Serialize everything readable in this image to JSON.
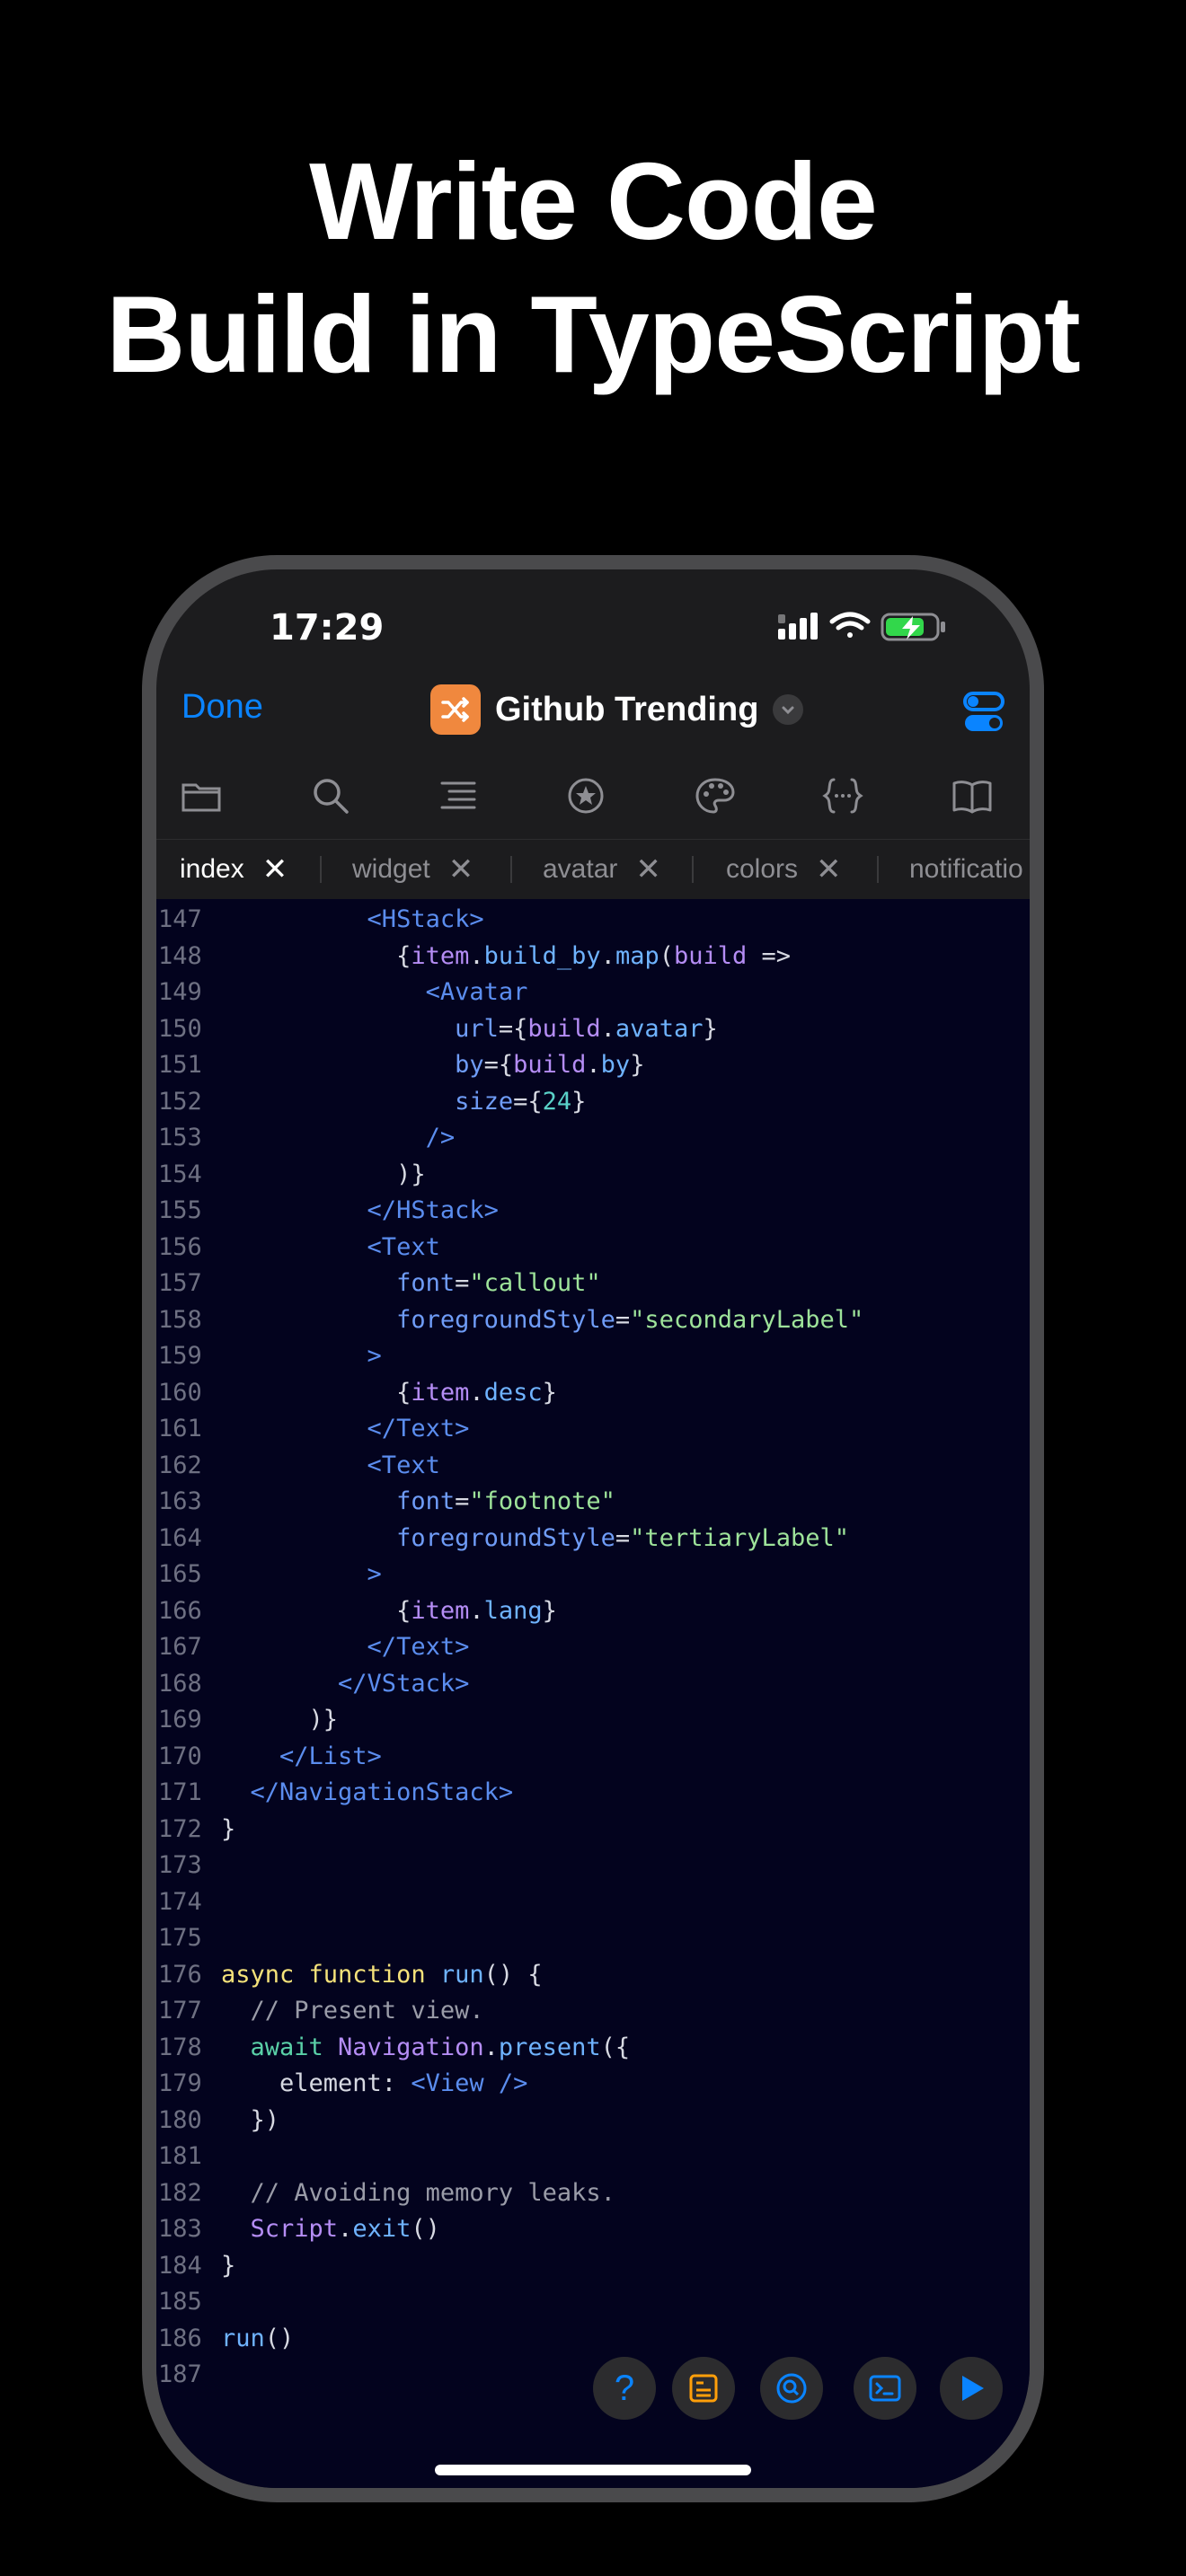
{
  "headline": {
    "line1": "Write Code",
    "line2": "Build in TypeScript"
  },
  "status_bar": {
    "time": "17:29"
  },
  "nav": {
    "done_label": "Done",
    "title": "Github Trending"
  },
  "toolbar_icons": [
    "folder-icon",
    "search-icon",
    "outline-icon",
    "star-icon",
    "palette-icon",
    "braces-icon",
    "book-icon"
  ],
  "tabs": [
    {
      "label": "index",
      "active": true
    },
    {
      "label": "widget"
    },
    {
      "label": "avatar"
    },
    {
      "label": "colors"
    },
    {
      "label": "notificatio"
    }
  ],
  "code": {
    "lines": [
      {
        "n": "147",
        "tokens": [
          [
            "tag",
            "          <HStack>"
          ]
        ]
      },
      {
        "n": "148",
        "tokens": [
          [
            "pl",
            "            {"
          ],
          [
            "prop",
            "item"
          ],
          [
            "pl",
            "."
          ],
          [
            "fn",
            "build_by"
          ],
          [
            "pl",
            "."
          ],
          [
            "fn",
            "map"
          ],
          [
            "pl",
            "("
          ],
          [
            "prop",
            "build"
          ],
          [
            "pl",
            " =>"
          ]
        ]
      },
      {
        "n": "149",
        "tokens": [
          [
            "tag",
            "              <Avatar"
          ]
        ]
      },
      {
        "n": "150",
        "tokens": [
          [
            "attr",
            "                url"
          ],
          [
            "pl",
            "={"
          ],
          [
            "prop",
            "build"
          ],
          [
            "pl",
            "."
          ],
          [
            "fn",
            "avatar"
          ],
          [
            "pl",
            "}"
          ]
        ]
      },
      {
        "n": "151",
        "tokens": [
          [
            "attr",
            "                by"
          ],
          [
            "pl",
            "={"
          ],
          [
            "prop",
            "build"
          ],
          [
            "pl",
            "."
          ],
          [
            "fn",
            "by"
          ],
          [
            "pl",
            "}"
          ]
        ]
      },
      {
        "n": "152",
        "tokens": [
          [
            "attr",
            "                size"
          ],
          [
            "pl",
            "={"
          ],
          [
            "num",
            "24"
          ],
          [
            "pl",
            "}"
          ]
        ]
      },
      {
        "n": "153",
        "tokens": [
          [
            "tag",
            "              />"
          ]
        ]
      },
      {
        "n": "154",
        "tokens": [
          [
            "pl",
            "            )}"
          ]
        ]
      },
      {
        "n": "155",
        "tokens": [
          [
            "tag",
            "          </HStack>"
          ]
        ]
      },
      {
        "n": "156",
        "tokens": [
          [
            "tag",
            "          <Text"
          ]
        ]
      },
      {
        "n": "157",
        "tokens": [
          [
            "attr",
            "            font"
          ],
          [
            "pl",
            "="
          ],
          [
            "str",
            "\"callout\""
          ]
        ]
      },
      {
        "n": "158",
        "tokens": [
          [
            "attr",
            "            foregroundStyle"
          ],
          [
            "pl",
            "="
          ],
          [
            "str",
            "\"secondaryLabel\""
          ]
        ]
      },
      {
        "n": "159",
        "tokens": [
          [
            "tag",
            "          >"
          ]
        ]
      },
      {
        "n": "160",
        "tokens": [
          [
            "pl",
            "            {"
          ],
          [
            "prop",
            "item"
          ],
          [
            "pl",
            "."
          ],
          [
            "fn",
            "desc"
          ],
          [
            "pl",
            "}"
          ]
        ]
      },
      {
        "n": "161",
        "tokens": [
          [
            "tag",
            "          </Text>"
          ]
        ]
      },
      {
        "n": "162",
        "tokens": [
          [
            "tag",
            "          <Text"
          ]
        ]
      },
      {
        "n": "163",
        "tokens": [
          [
            "attr",
            "            font"
          ],
          [
            "pl",
            "="
          ],
          [
            "str",
            "\"footnote\""
          ]
        ]
      },
      {
        "n": "164",
        "tokens": [
          [
            "attr",
            "            foregroundStyle"
          ],
          [
            "pl",
            "="
          ],
          [
            "str",
            "\"tertiaryLabel\""
          ]
        ]
      },
      {
        "n": "165",
        "tokens": [
          [
            "tag",
            "          >"
          ]
        ]
      },
      {
        "n": "166",
        "tokens": [
          [
            "pl",
            "            {"
          ],
          [
            "prop",
            "item"
          ],
          [
            "pl",
            "."
          ],
          [
            "fn",
            "lang"
          ],
          [
            "pl",
            "}"
          ]
        ]
      },
      {
        "n": "167",
        "tokens": [
          [
            "tag",
            "          </Text>"
          ]
        ]
      },
      {
        "n": "168",
        "tokens": [
          [
            "tag",
            "        </VStack>"
          ]
        ]
      },
      {
        "n": "169",
        "tokens": [
          [
            "pl",
            "      )}"
          ]
        ]
      },
      {
        "n": "170",
        "tokens": [
          [
            "tag",
            "    </List>"
          ]
        ]
      },
      {
        "n": "171",
        "tokens": [
          [
            "tag",
            "  </NavigationStack>"
          ]
        ]
      },
      {
        "n": "172",
        "tokens": [
          [
            "pl",
            "}"
          ]
        ]
      },
      {
        "n": "173",
        "tokens": []
      },
      {
        "n": "174",
        "tokens": []
      },
      {
        "n": "175",
        "tokens": []
      },
      {
        "n": "176",
        "tokens": [
          [
            "kw",
            "async function "
          ],
          [
            "fn",
            "run"
          ],
          [
            "pl",
            "() {"
          ]
        ]
      },
      {
        "n": "177",
        "tokens": [
          [
            "cmt",
            "  // Present view."
          ]
        ]
      },
      {
        "n": "178",
        "tokens": [
          [
            "kw2",
            "  await "
          ],
          [
            "id",
            "Navigation"
          ],
          [
            "pl",
            "."
          ],
          [
            "fn",
            "present"
          ],
          [
            "pl",
            "({"
          ]
        ]
      },
      {
        "n": "179",
        "tokens": [
          [
            "pl",
            "    element: "
          ],
          [
            "tag",
            "<View />"
          ]
        ]
      },
      {
        "n": "180",
        "tokens": [
          [
            "pl",
            "  })"
          ]
        ]
      },
      {
        "n": "181",
        "tokens": []
      },
      {
        "n": "182",
        "tokens": [
          [
            "cmt",
            "  // Avoiding memory leaks."
          ]
        ]
      },
      {
        "n": "183",
        "tokens": [
          [
            "id",
            "  Script"
          ],
          [
            "pl",
            "."
          ],
          [
            "fn",
            "exit"
          ],
          [
            "pl",
            "()"
          ]
        ]
      },
      {
        "n": "184",
        "tokens": [
          [
            "pl",
            "}"
          ]
        ]
      },
      {
        "n": "185",
        "tokens": []
      },
      {
        "n": "186",
        "tokens": [
          [
            "fn",
            "run"
          ],
          [
            "pl",
            "()"
          ]
        ]
      },
      {
        "n": "187",
        "tokens": []
      }
    ]
  },
  "bottom_buttons": {
    "help_label": "?"
  },
  "colors": {
    "accent": "#0a84ff",
    "app_badge": "#f0883e",
    "editor_bg": "#03031e"
  }
}
